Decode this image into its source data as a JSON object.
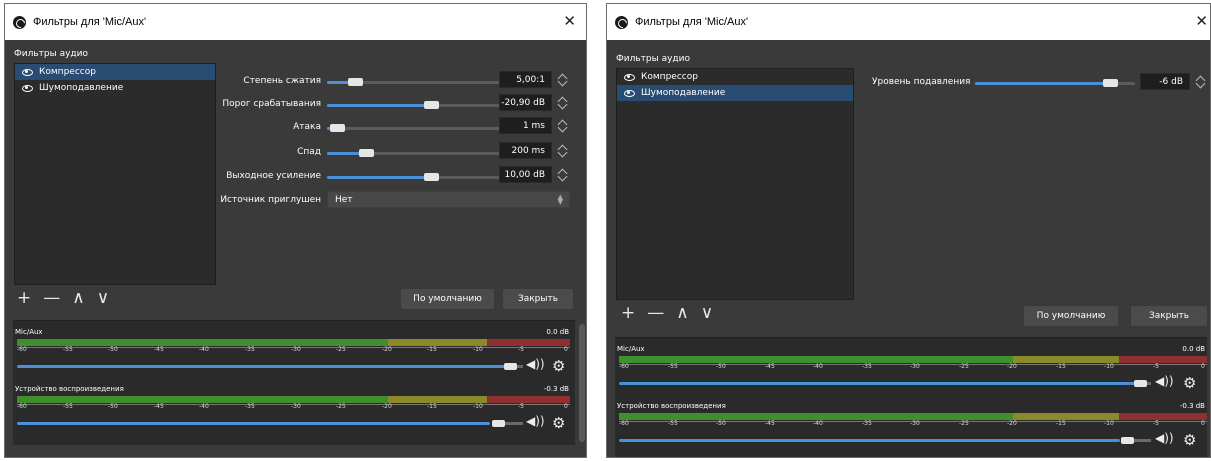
{
  "window_title": "Фильтры для 'Mic/Aux'",
  "audio_filters_label": "Фильтры аудио",
  "filters": [
    {
      "name": "Компрессор"
    },
    {
      "name": "Шумоподавление"
    }
  ],
  "compressor": {
    "ratio": {
      "label": "Степень сжатия",
      "value": "5,00:1",
      "fraction": 0.13
    },
    "threshold": {
      "label": "Порог срабатывания",
      "value": "-20,90 dB",
      "fraction": 0.6
    },
    "attack": {
      "label": "Атака",
      "value": "1 ms",
      "fraction": 0.02
    },
    "release": {
      "label": "Спад",
      "value": "200 ms",
      "fraction": 0.2
    },
    "output_gain": {
      "label": "Выходное усиление",
      "value": "10,00 dB",
      "fraction": 0.6
    },
    "sidechain": {
      "label": "Источник приглушен",
      "value": "Нет"
    }
  },
  "noise_suppression": {
    "level": {
      "label": "Уровень подавления",
      "value": "-6 dB",
      "fraction": 0.88
    }
  },
  "controls": {
    "add": "+",
    "remove": "—",
    "up": "∧",
    "down": "∨"
  },
  "buttons": {
    "defaults": "По умолчанию",
    "close": "Закрыть"
  },
  "mixer": {
    "channels": [
      {
        "name": "Mic/Aux",
        "db": "0.0 dB",
        "volume_fraction": 1.0
      },
      {
        "name": "Устройство воспроизведения",
        "db": "-0.3 dB",
        "volume_fraction": 0.97
      }
    ],
    "ticks": [
      "-60",
      "-55",
      "-50",
      "-45",
      "-40",
      "-35",
      "-30",
      "-25",
      "-20",
      "-15",
      "-10",
      "-5",
      "0"
    ]
  },
  "colors": {
    "selection": "#284c72",
    "slider_fill": "#4a90d9",
    "meter_green": "#3f8f2f",
    "meter_yellow": "#8a8a2a",
    "meter_red": "#8f2f2f"
  },
  "icons": {
    "visibility": "eye-icon",
    "speaker": "speaker-icon",
    "settings": "gear-icon",
    "close": "close-icon"
  }
}
